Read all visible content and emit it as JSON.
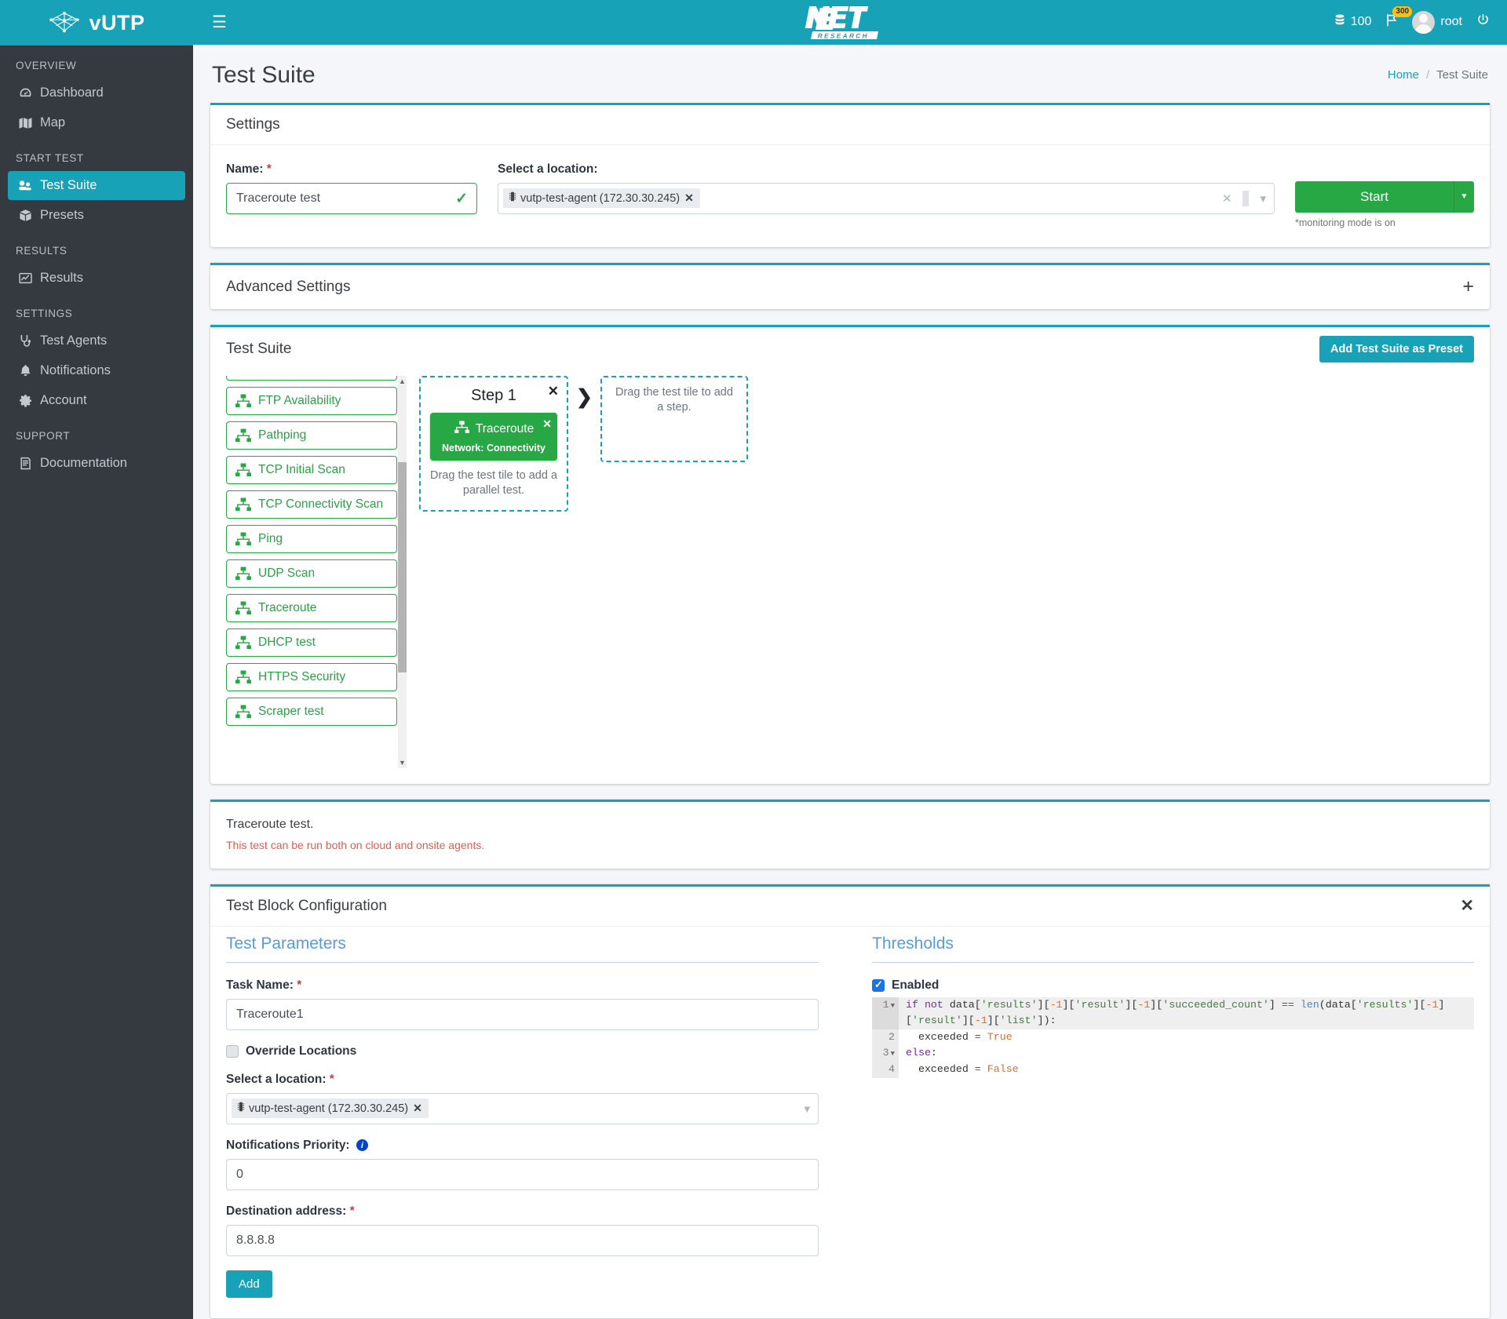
{
  "brand": {
    "name": "vUTP"
  },
  "topbar": {
    "hamburger_icon": "hamburger-icon",
    "logo_main": "NET",
    "logo_sub": "RESEARCH",
    "credits": "100",
    "flag_badge": "300",
    "username": "root",
    "power_icon": "power-icon"
  },
  "sidebar": {
    "groups": [
      {
        "header": "OVERVIEW",
        "items": [
          {
            "label": "Dashboard",
            "icon": "dashboard-icon",
            "active": false
          },
          {
            "label": "Map",
            "icon": "map-icon",
            "active": false
          }
        ]
      },
      {
        "header": "START TEST",
        "items": [
          {
            "label": "Test Suite",
            "icon": "test-suite-icon",
            "active": true
          },
          {
            "label": "Presets",
            "icon": "box-icon",
            "active": false
          }
        ]
      },
      {
        "header": "RESULTS",
        "items": [
          {
            "label": "Results",
            "icon": "chart-icon",
            "active": false
          }
        ]
      },
      {
        "header": "SETTINGS",
        "items": [
          {
            "label": "Test Agents",
            "icon": "stethoscope-icon",
            "active": false
          },
          {
            "label": "Notifications",
            "icon": "bell-icon",
            "active": false
          },
          {
            "label": "Account",
            "icon": "gear-icon",
            "active": false
          }
        ]
      },
      {
        "header": "SUPPORT",
        "items": [
          {
            "label": "Documentation",
            "icon": "book-icon",
            "active": false
          }
        ]
      }
    ]
  },
  "page": {
    "title": "Test Suite",
    "breadcrumb_home": "Home",
    "breadcrumb_sep": "/",
    "breadcrumb_current": "Test Suite"
  },
  "settings_card": {
    "title": "Settings",
    "name_label": "Name:",
    "name_value": "Traceroute test",
    "name_valid_icon": "check-icon",
    "location_label": "Select a location:",
    "location_chip": "vutp-test-agent (172.30.30.245)",
    "clear_icon": "clear-icon",
    "chevron_icon": "chevron-down-icon",
    "start_label": "Start",
    "start_caret_icon": "caret-down-icon",
    "monitoring_note": "*monitoring mode is on"
  },
  "advanced_card": {
    "title": "Advanced Settings",
    "expand_icon": "plus-icon"
  },
  "test_suite_card": {
    "title": "Test Suite",
    "add_preset_label": "Add Test Suite as Preset",
    "tiles": [
      {
        "label": "FTP Availability",
        "icon": "network-icon"
      },
      {
        "label": "Pathping",
        "icon": "network-icon"
      },
      {
        "label": "TCP Initial Scan",
        "icon": "network-icon"
      },
      {
        "label": "TCP Connectivity Scan",
        "icon": "network-icon"
      },
      {
        "label": "Ping",
        "icon": "network-icon"
      },
      {
        "label": "UDP Scan",
        "icon": "network-icon"
      },
      {
        "label": "Traceroute",
        "icon": "network-icon"
      },
      {
        "label": "DHCP test",
        "icon": "network-icon"
      },
      {
        "label": "HTTPS Security",
        "icon": "network-icon"
      },
      {
        "label": "Scraper test",
        "icon": "network-icon"
      }
    ],
    "step": {
      "title": "Step 1",
      "close_icon": "close-icon",
      "tile_label": "Traceroute",
      "tile_sub": "Network: Connectivity",
      "tile_close_icon": "close-icon",
      "parallel_hint": "Drag the test tile to add a parallel test."
    },
    "arrow_icon": "chevron-right-icon",
    "drop_hint": "Drag the test tile to add a step."
  },
  "description_card": {
    "title": "Traceroute test.",
    "subtitle": "This test can be run both on cloud and onsite agents."
  },
  "config_card": {
    "title": "Test Block Configuration",
    "close_icon": "close-icon",
    "parameters": {
      "section_title": "Test Parameters",
      "task_name_label": "Task Name:",
      "task_name_value": "Traceroute1",
      "override_label": "Override Locations",
      "override_checked": false,
      "location_label": "Select a location:",
      "location_chip": "vutp-test-agent (172.30.30.245)",
      "chevron_icon": "chevron-down-icon",
      "priority_label": "Notifications Priority:",
      "priority_info_icon": "info-icon",
      "priority_value": "0",
      "destination_label": "Destination address:",
      "destination_value": "8.8.8.8",
      "add_label": "Add"
    },
    "thresholds": {
      "section_title": "Thresholds",
      "enabled_label": "Enabled",
      "enabled_checked": true,
      "code_lines": [
        {
          "num": "1",
          "fold": true,
          "text": "if not data['results'][-1]['result'][-1]['succeeded_count'] == len(data['results'][-1]['result'][-1]['list']):"
        },
        {
          "num": "2",
          "fold": false,
          "text": "  exceeded = True"
        },
        {
          "num": "3",
          "fold": true,
          "text": "else:"
        },
        {
          "num": "4",
          "fold": false,
          "text": "  exceeded = False"
        }
      ]
    }
  },
  "colors": {
    "accent_teal": "#17a2b8",
    "sidebar_dark": "#343a40",
    "success_green": "#28a745",
    "danger_red": "#dc3545",
    "link_blue": "#5b9bd5"
  }
}
